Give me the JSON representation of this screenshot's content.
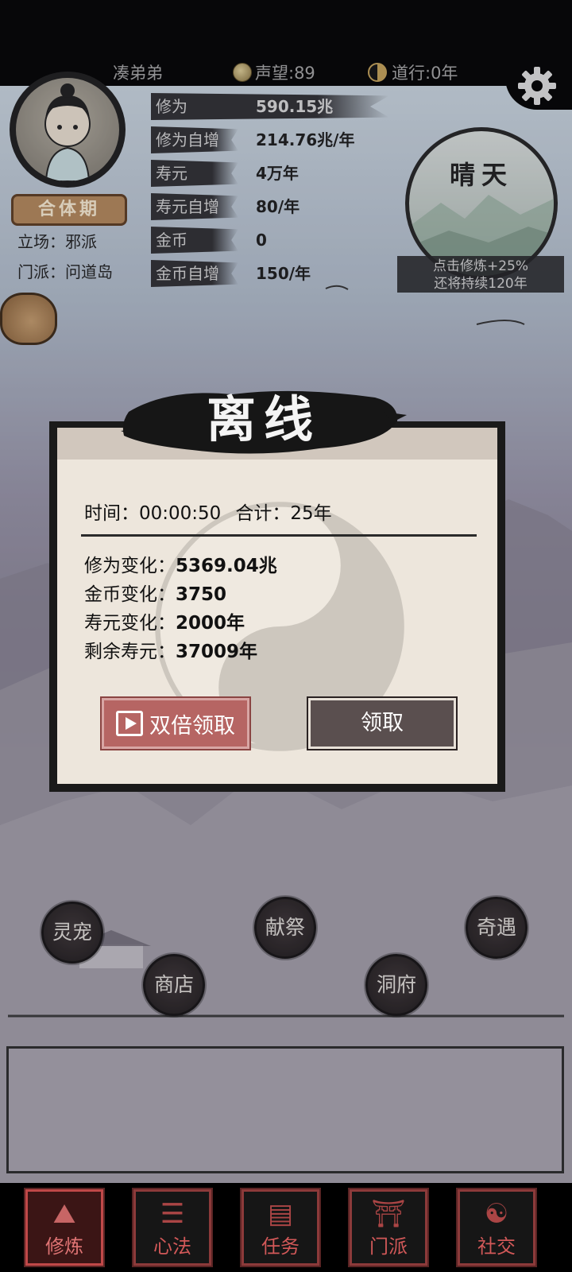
{
  "status_bar": {
    "player_name": "凑弟弟",
    "fame": "声望:89",
    "dao_years": "道行:0年"
  },
  "player": {
    "rank": "合体期",
    "stance": "立场：邪派",
    "sect": "门派：问道岛"
  },
  "stats": [
    {
      "label": "修为",
      "value": "590.15兆"
    },
    {
      "label": "修为自增",
      "value": "214.76兆/年"
    },
    {
      "label": "寿元",
      "value": "4万年"
    },
    {
      "label": "寿元自增",
      "value": "80/年"
    },
    {
      "label": "金币",
      "value": "0"
    },
    {
      "label": "金币自增",
      "value": "150/年"
    }
  ],
  "weather": {
    "title": "晴天",
    "tip_line1": "点击修炼+25%",
    "tip_line2": "还将持续120年"
  },
  "offline_dialog": {
    "title": "离线",
    "time_text": "时间：00:00:50",
    "total_text": "合计：25年",
    "changes": [
      {
        "label": "修为变化：",
        "value": "5369.04兆"
      },
      {
        "label": "金币变化：",
        "value": "3750"
      },
      {
        "label": "寿元变化：",
        "value": "2000年"
      },
      {
        "label": "剩余寿元：",
        "value": "37009年"
      }
    ],
    "double_claim_label": "双倍领取",
    "claim_label": "领取"
  },
  "map_buttons": {
    "pet": "灵宠",
    "sacrifice": "献祭",
    "adventure": "奇遇",
    "shop": "商店",
    "cave": "洞府"
  },
  "nav": {
    "cultivate": "修炼",
    "method": "心法",
    "task": "任务",
    "sect": "门派",
    "social": "社交"
  },
  "colors": {
    "accent_red": "#b66563",
    "dark_button": "#5a4f4f",
    "nav_red": "#c54e4e"
  }
}
